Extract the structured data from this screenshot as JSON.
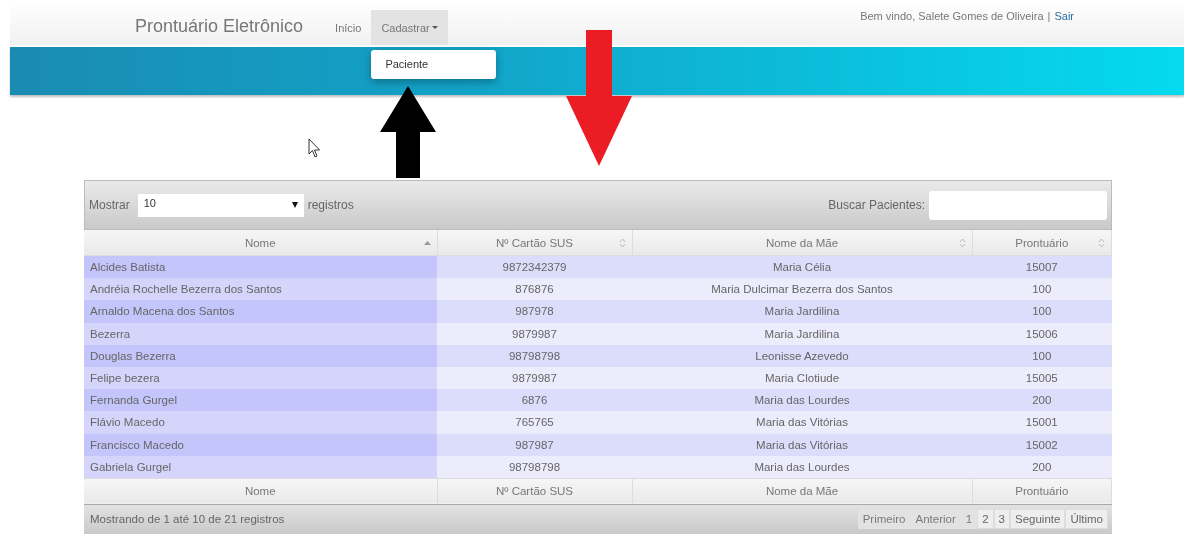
{
  "navbar": {
    "brand": "Prontuário Eletrônico",
    "items": [
      {
        "label": "Início",
        "expanded": false
      },
      {
        "label": "Cadastrar",
        "expanded": true,
        "menu": [
          "Paciente"
        ]
      }
    ],
    "welcome": "Bem vindo, Salete Gomes de Oliveira",
    "separator": "|",
    "logout": "Sair"
  },
  "table": {
    "length_label": "Mostrar",
    "length_value": "10",
    "length_suffix": "registros",
    "search_label": "Buscar Pacientes:",
    "columns": [
      {
        "label": "Nome",
        "sorted": true
      },
      {
        "label": "Nº Cartão SUS",
        "sorted": false
      },
      {
        "label": "Nome da Mãe",
        "sorted": false
      },
      {
        "label": "Prontuário",
        "sorted": false
      }
    ],
    "rows": [
      [
        "Alcides Batista",
        "9872342379",
        "Maria Célia",
        "15007"
      ],
      [
        "Andréia Rochelle Bezerra dos Santos",
        "876876",
        "Maria Dulcimar Bezerra dos Santos",
        "100"
      ],
      [
        "Arnaldo Macena dos Santos",
        "987978",
        "Maria Jardilina",
        "100"
      ],
      [
        "Bezerra",
        "9879987",
        "Maria Jardilina",
        "15006"
      ],
      [
        "Douglas Bezerra",
        "98798798",
        "Leonisse Azevedo",
        "100"
      ],
      [
        "Felipe bezera",
        "9879987",
        "Maria Clotiude",
        "15005"
      ],
      [
        "Fernanda Gurgel",
        "6876",
        "Maria das Lourdes",
        "200"
      ],
      [
        "Flávio Macedo",
        "765765",
        "Maria das Vitórias",
        "15001"
      ],
      [
        "Francisco Macedo",
        "987987",
        "Maria das Vitórias",
        "15002"
      ],
      [
        "Gabriela Gurgel",
        "98798798",
        "Maria das Lourdes",
        "200"
      ]
    ],
    "footer_columns": [
      "Nome",
      "Nº Cartão SUS",
      "Nome da Mãe",
      "Prontuário"
    ],
    "info": "Mostrando de 1 até 10 de 21 registros",
    "pagination": [
      {
        "label": "Primeiro",
        "disabled": true
      },
      {
        "label": "Anterior",
        "disabled": true
      },
      {
        "label": "1",
        "disabled": true
      },
      {
        "label": "2",
        "disabled": false
      },
      {
        "label": "3",
        "disabled": false
      },
      {
        "label": "Seguinte",
        "disabled": false
      },
      {
        "label": "Último",
        "disabled": false
      }
    ]
  }
}
